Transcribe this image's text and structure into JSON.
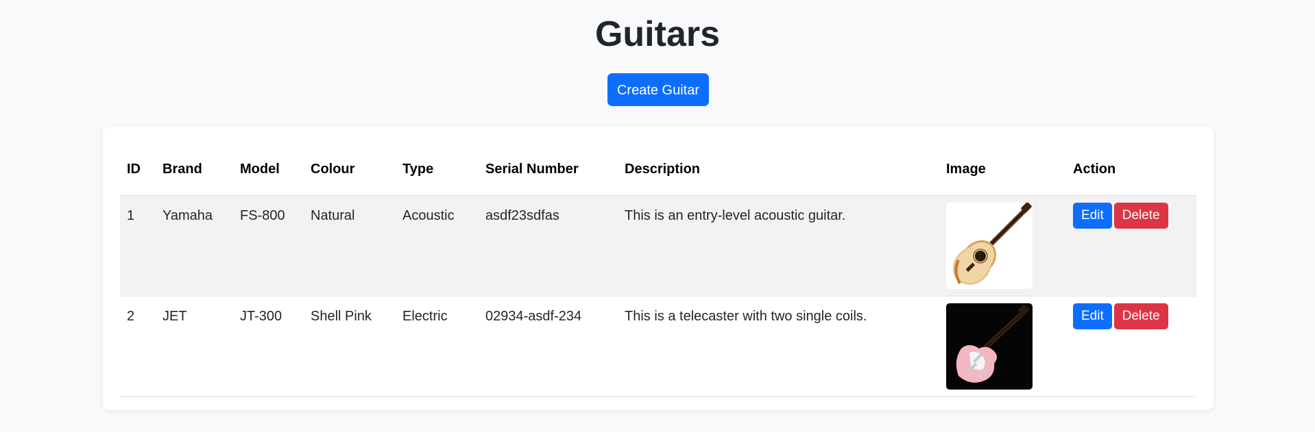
{
  "page": {
    "title": "Guitars",
    "create_button_label": "Create Guitar"
  },
  "table": {
    "columns": [
      "ID",
      "Brand",
      "Model",
      "Colour",
      "Type",
      "Serial Number",
      "Description",
      "Image",
      "Action"
    ],
    "rows": [
      {
        "id": "1",
        "brand": "Yamaha",
        "model": "FS-800",
        "colour": "Natural",
        "type": "Acoustic",
        "serial": "asdf23sdfas",
        "description": "This is an entry-level acoustic guitar.",
        "image_icon": "acoustic-guitar-image",
        "edit_label": "Edit",
        "delete_label": "Delete"
      },
      {
        "id": "2",
        "brand": "JET",
        "model": "JT-300",
        "colour": "Shell Pink",
        "type": "Electric",
        "serial": "02934-asdf-234",
        "description": "This is a telecaster with two single coils.",
        "image_icon": "electric-guitar-image",
        "edit_label": "Edit",
        "delete_label": "Delete"
      }
    ]
  },
  "colors": {
    "primary": "#0d6efd",
    "danger": "#dc3545",
    "background": "#f8f9fa",
    "striped_row": "#f2f2f2"
  }
}
